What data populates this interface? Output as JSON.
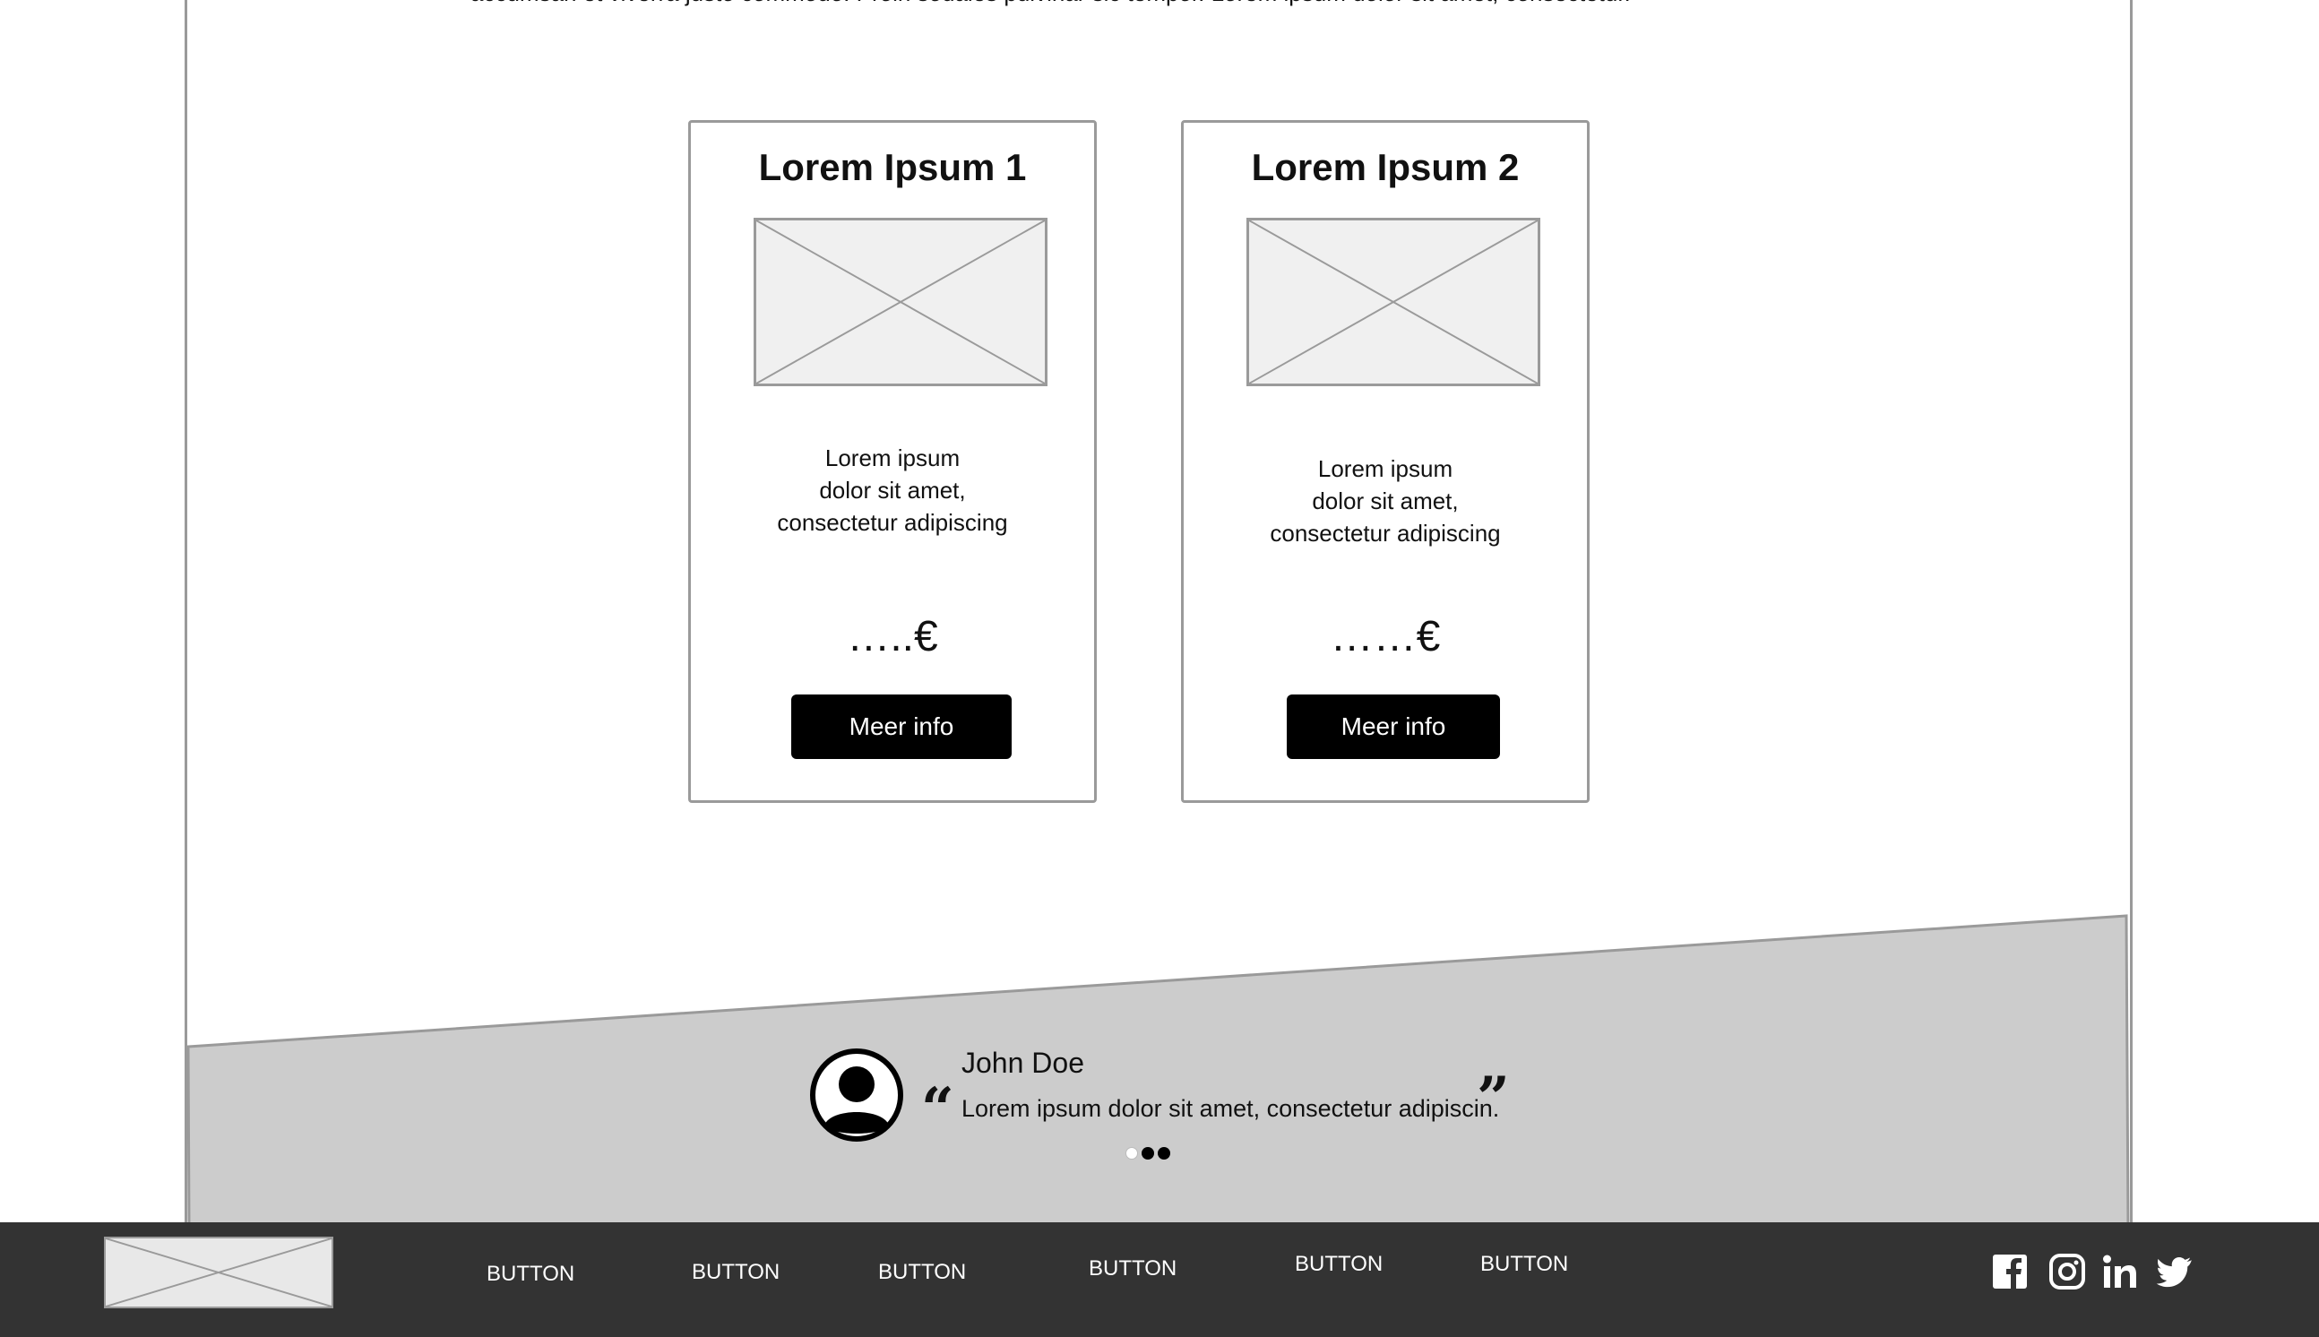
{
  "intro": {
    "text": "accumsan et viverra justo commodo. Proin sodales pulvinar sic tempor.  Lorem ipsum dolor sit amet, consectetur."
  },
  "cards": [
    {
      "title": "Lorem Ipsum 1",
      "image_icon": "image-placeholder-icon",
      "desc_line1": "Lorem ipsum",
      "desc_line2": "dolor sit amet,",
      "desc_line3": "consectetur adipiscing",
      "price": "…..€",
      "button_label": "Meer info"
    },
    {
      "title": "Lorem Ipsum 2",
      "image_icon": "image-placeholder-icon",
      "desc_line1": "Lorem ipsum",
      "desc_line2": "dolor sit amet,",
      "desc_line3": "consectetur adipiscing",
      "price": "……€",
      "button_label": "Meer info"
    }
  ],
  "testimonial": {
    "avatar_icon": "user-avatar-icon",
    "name": "John Doe",
    "quote": "Lorem ipsum dolor sit amet, consectetur adipiscin.",
    "open_quote": "“",
    "close_quote": "”",
    "active_dot": 0,
    "dot_count": 3
  },
  "footer": {
    "logo_icon": "logo-placeholder-icon",
    "nav": [
      "BUTTON",
      "BUTTON",
      "BUTTON",
      "BUTTON",
      "BUTTON",
      "BUTTON"
    ],
    "social": [
      "facebook-icon",
      "instagram-icon",
      "linkedin-icon",
      "twitter-icon"
    ]
  },
  "colors": {
    "band": "#cccccc",
    "footer": "#333333",
    "button": "#000000",
    "border": "#9a9a9a"
  }
}
